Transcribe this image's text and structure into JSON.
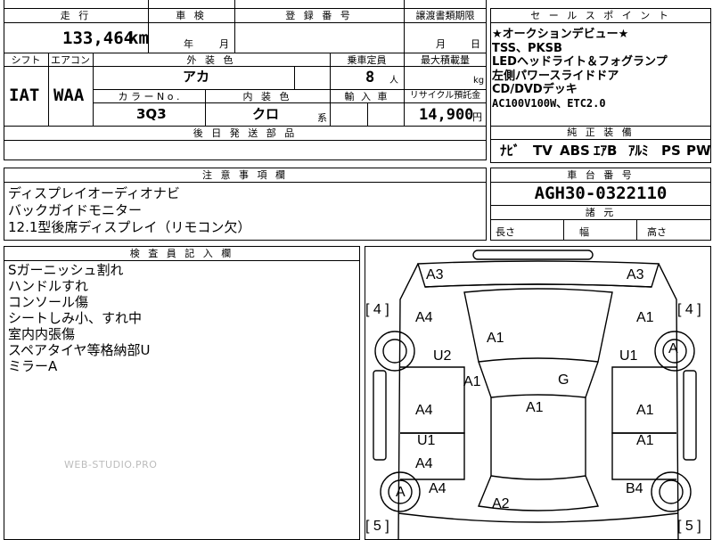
{
  "sheet": {
    "mileage_header": "走 行",
    "mileage": "133,464",
    "mileage_unit": "km",
    "inspection_header": "車 検",
    "inspection_year": "年",
    "inspection_month": "月",
    "registration_header": "登 録 番 号",
    "transfer_header": "譲渡書類期限",
    "transfer_month": "月",
    "transfer_day": "日",
    "shift_header": "シフト",
    "shift": "IAT",
    "ac_header": "エアコン",
    "ac": "WAA",
    "ext_color_header": "外 装 色",
    "ext_color": "アカ",
    "capacity_header": "乗車定員",
    "capacity": "8",
    "capacity_unit": "人",
    "load_header": "最大積載量",
    "load_unit": "kg",
    "color_no_header": "カ ラ ー N o .",
    "color_no": "3Q3",
    "int_color_header": "内 装 色",
    "int_color": "クロ",
    "int_color_unit": "系",
    "import_header": "輸 入 車",
    "recycle_header": "リサイクル預託金",
    "recycle": "14,900",
    "recycle_unit": "円",
    "later_parts_header": "後 日 発 送 部 品"
  },
  "sales_points": {
    "header": "セ ー ル ス ポ イ ン ト",
    "lines": [
      "★オークションデビュー★",
      "TSS、PKSB",
      "LEDヘッドライト＆フォグランプ",
      "左側パワースライドドア",
      "CD/DVDデッキ",
      "AC100V100W、ETC2.0"
    ]
  },
  "equipment": {
    "header": "純 正 装 備",
    "items": [
      "ﾅﾋﾞ",
      "TV",
      "ABS",
      "ｴｱB",
      "ｱﾙﾐ",
      "PS",
      "PW"
    ]
  },
  "notes": {
    "header": "注 意 事 項 欄",
    "lines": [
      "ディスプレイオーディオナビ",
      "バックガイドモニター",
      "12.1型後席ディスプレイ（リモコン欠）"
    ]
  },
  "chassis": {
    "header": "車 台 番 号",
    "value": "AGH30-0322110"
  },
  "dimensions": {
    "header": "諸 元",
    "length": "長さ",
    "width": "幅",
    "height": "高さ"
  },
  "inspector": {
    "header": "検 査 員 記 入 欄",
    "lines": [
      "Sガーニッシュ割れ",
      "ハンドルすれ",
      "コンソール傷",
      "シートしみ小、すれ中",
      "室内内張傷",
      "スペアタイヤ等格納部U",
      "ミラーA"
    ]
  },
  "watermark": "WEB-STUDIO.PRO",
  "diagram": {
    "tire_front_left": "[ 4 ]",
    "tire_front_right": "[ 4 ]",
    "tire_rear_left": "[ 5 ]",
    "tire_rear_right": "[ 5 ]",
    "marks": {
      "a3_left": "A3",
      "a3_right": "A3",
      "a4_front_left": "A4",
      "a1_front_right": "A1",
      "a1_hood": "A1",
      "u2_left": "U2",
      "u1_right": "U1",
      "a_wheel_front_right": "A",
      "a1_glass": "A1",
      "g_glass": "G",
      "a4_front_door": "A4",
      "a1_roof": "A1",
      "a1_right_door": "A1",
      "u1_rear_left": "U1",
      "a1_rear_right": "A1",
      "a4_rear_left": "A4",
      "a_wheel_rear_left": "A",
      "a4_rear_quarter": "A4",
      "b4_rear_right": "B4",
      "a2_rear": "A2"
    }
  }
}
